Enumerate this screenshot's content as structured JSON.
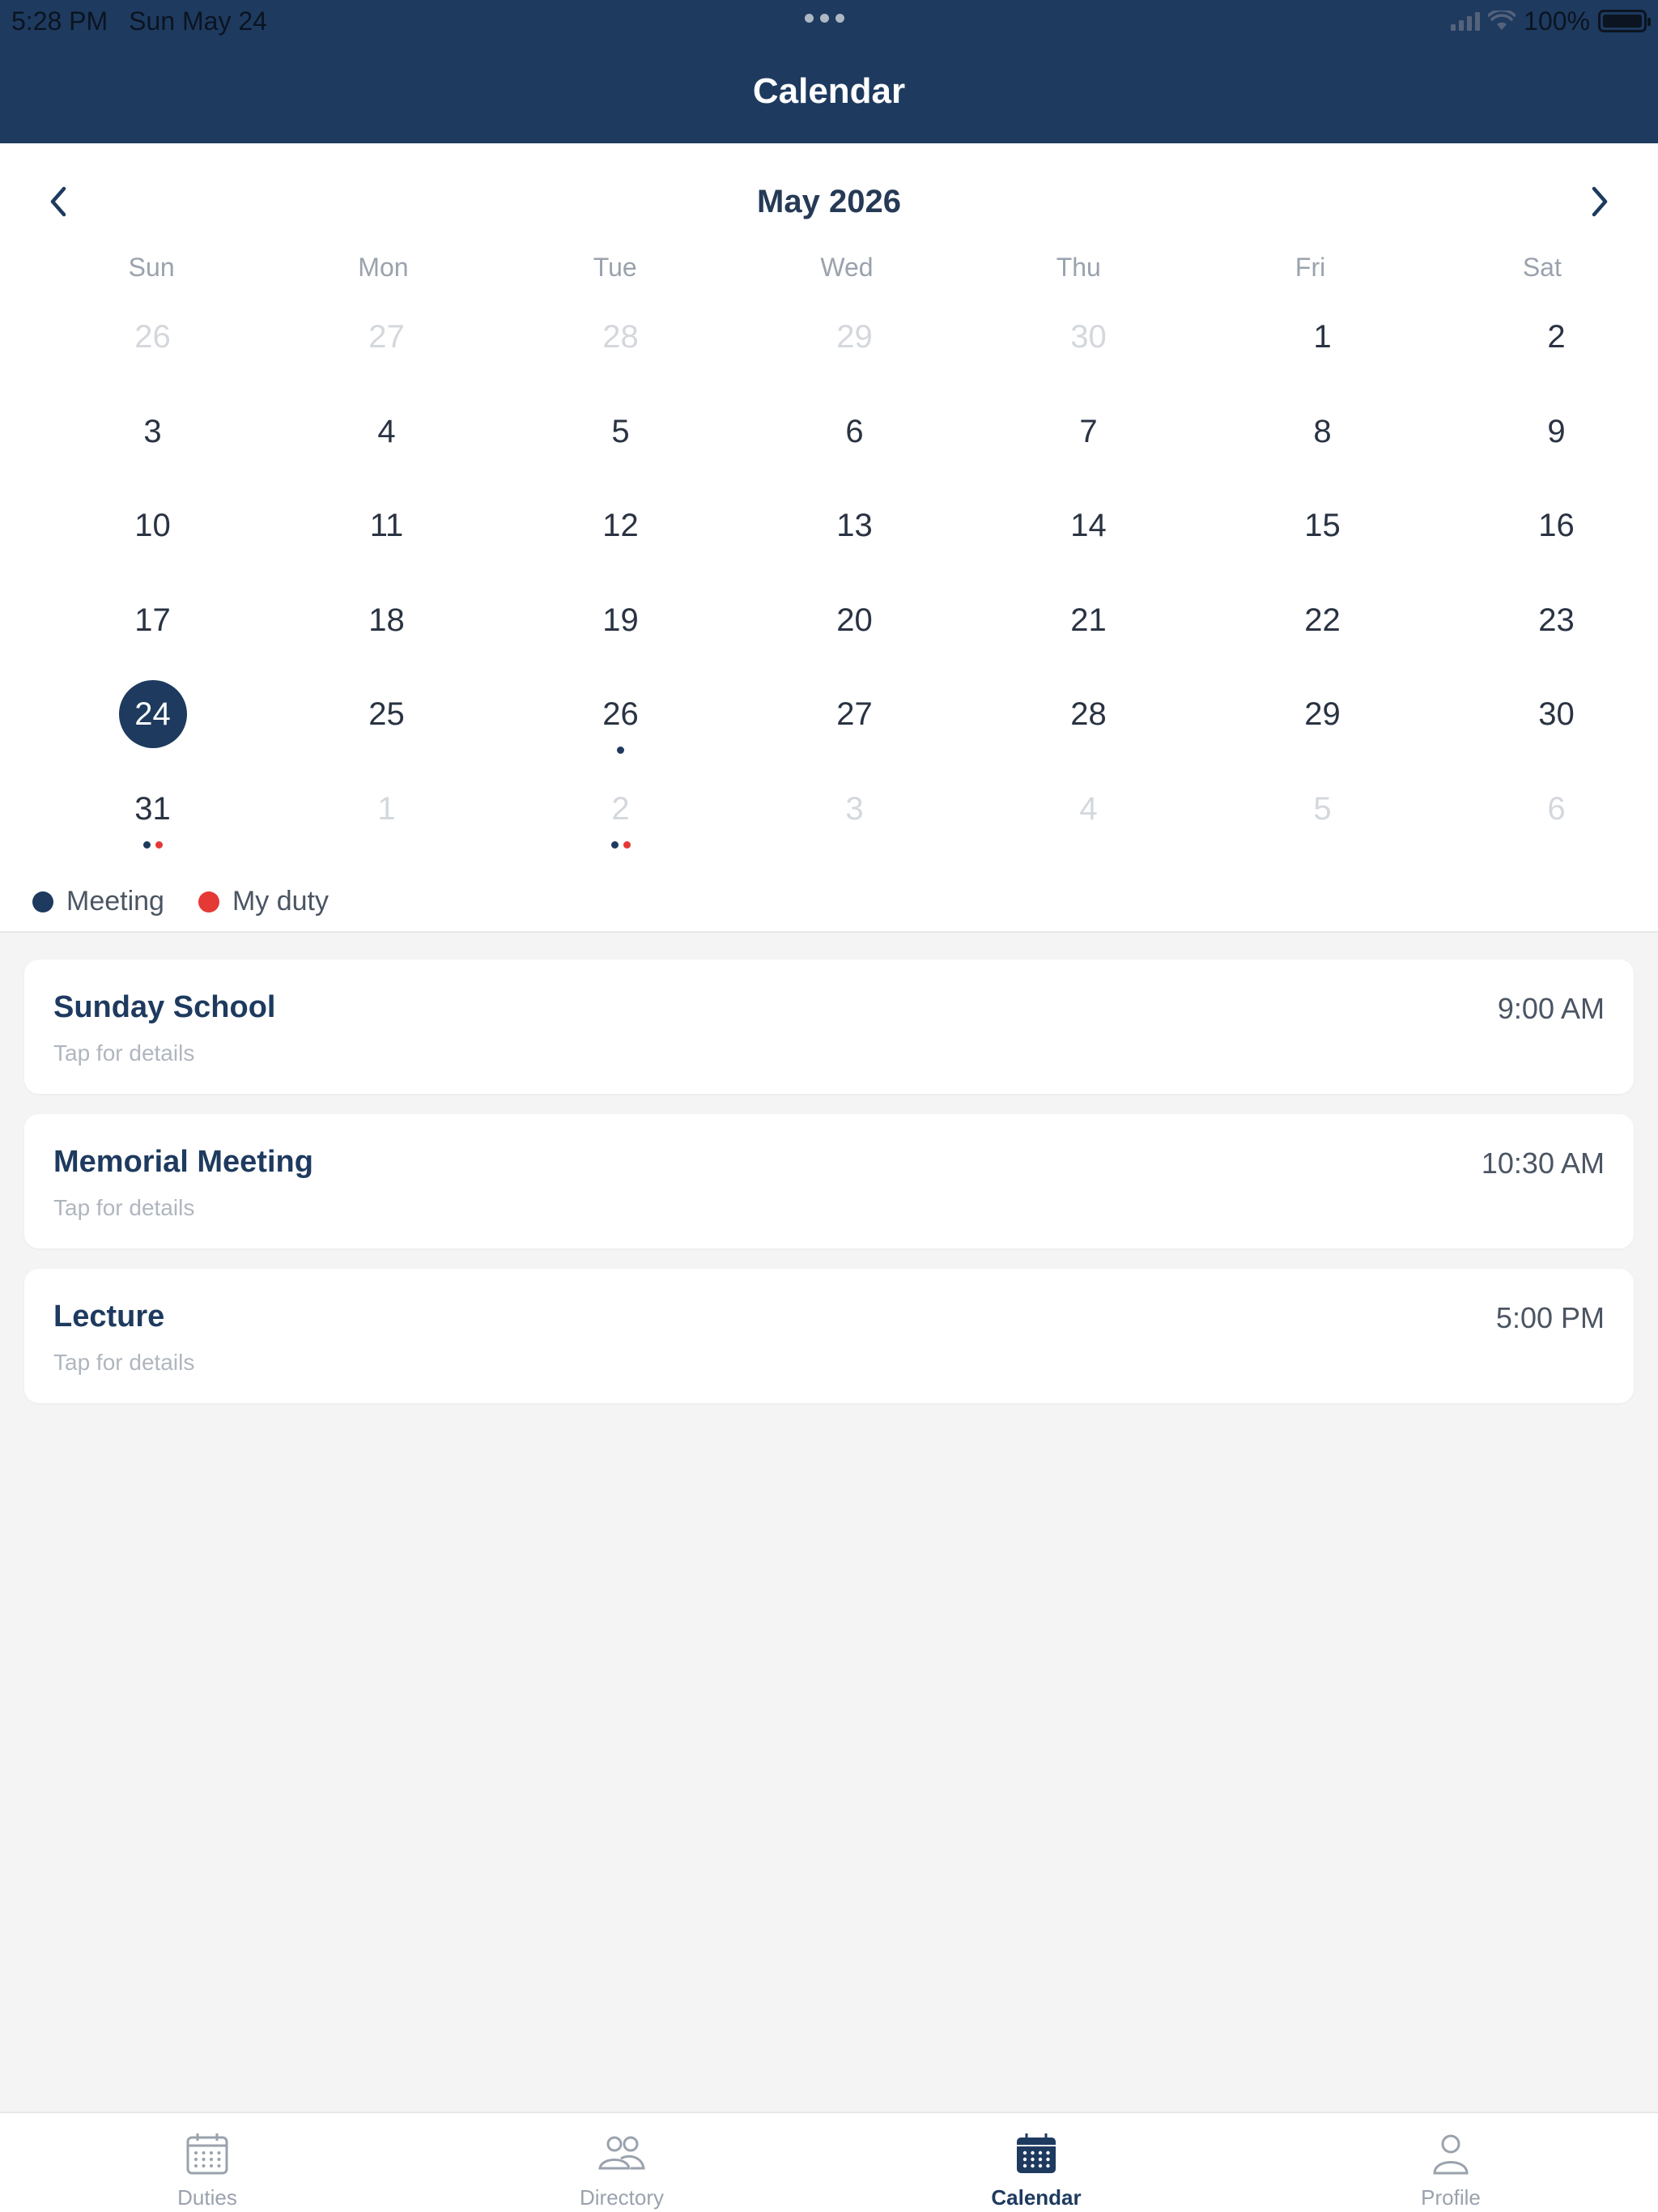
{
  "status_bar": {
    "time": "5:28 PM",
    "date": "Sun May 24",
    "battery": "100%"
  },
  "header": {
    "title": "Calendar"
  },
  "calendar": {
    "month_label": "May 2026",
    "weekdays": [
      "Sun",
      "Mon",
      "Tue",
      "Wed",
      "Thu",
      "Fri",
      "Sat"
    ],
    "weeks": [
      [
        {
          "label": "26",
          "muted": true
        },
        {
          "label": "27",
          "muted": true
        },
        {
          "label": "28",
          "muted": true
        },
        {
          "label": "29",
          "muted": true
        },
        {
          "label": "30",
          "muted": true
        },
        {
          "label": "1"
        },
        {
          "label": "2"
        }
      ],
      [
        {
          "label": "3"
        },
        {
          "label": "4"
        },
        {
          "label": "5"
        },
        {
          "label": "6"
        },
        {
          "label": "7"
        },
        {
          "label": "8"
        },
        {
          "label": "9"
        }
      ],
      [
        {
          "label": "10"
        },
        {
          "label": "11"
        },
        {
          "label": "12"
        },
        {
          "label": "13"
        },
        {
          "label": "14"
        },
        {
          "label": "15"
        },
        {
          "label": "16"
        }
      ],
      [
        {
          "label": "17"
        },
        {
          "label": "18"
        },
        {
          "label": "19"
        },
        {
          "label": "20"
        },
        {
          "label": "21"
        },
        {
          "label": "22"
        },
        {
          "label": "23"
        }
      ],
      [
        {
          "label": "24",
          "selected": true
        },
        {
          "label": "25"
        },
        {
          "label": "26",
          "dots": [
            "meeting"
          ]
        },
        {
          "label": "27"
        },
        {
          "label": "28"
        },
        {
          "label": "29"
        },
        {
          "label": "30"
        }
      ],
      [
        {
          "label": "31",
          "dots": [
            "meeting",
            "duty"
          ]
        },
        {
          "label": "1",
          "muted": true
        },
        {
          "label": "2",
          "muted": true,
          "dots": [
            "meeting",
            "duty"
          ]
        },
        {
          "label": "3",
          "muted": true
        },
        {
          "label": "4",
          "muted": true
        },
        {
          "label": "5",
          "muted": true
        },
        {
          "label": "6",
          "muted": true
        }
      ]
    ],
    "legend": [
      {
        "key": "meeting",
        "label": "Meeting",
        "color": "#1e3a5f"
      },
      {
        "key": "duty",
        "label": "My duty",
        "color": "#e53935"
      }
    ]
  },
  "events": [
    {
      "name": "Sunday School",
      "hint": "Tap for details",
      "time": "9:00 AM"
    },
    {
      "name": "Memorial Meeting",
      "hint": "Tap for details",
      "time": "10:30 AM"
    },
    {
      "name": "Lecture",
      "hint": "Tap for details",
      "time": "5:00 PM"
    }
  ],
  "tabs": [
    {
      "label": "Duties",
      "icon": "calendar-grid-icon",
      "active": false
    },
    {
      "label": "Directory",
      "icon": "people-icon",
      "active": false
    },
    {
      "label": "Calendar",
      "icon": "calendar-icon",
      "active": true
    },
    {
      "label": "Profile",
      "icon": "person-icon",
      "active": false
    }
  ],
  "colors": {
    "primary": "#1e3a5f",
    "duty": "#e53935",
    "inactive_tab": "#9aa2ad"
  }
}
